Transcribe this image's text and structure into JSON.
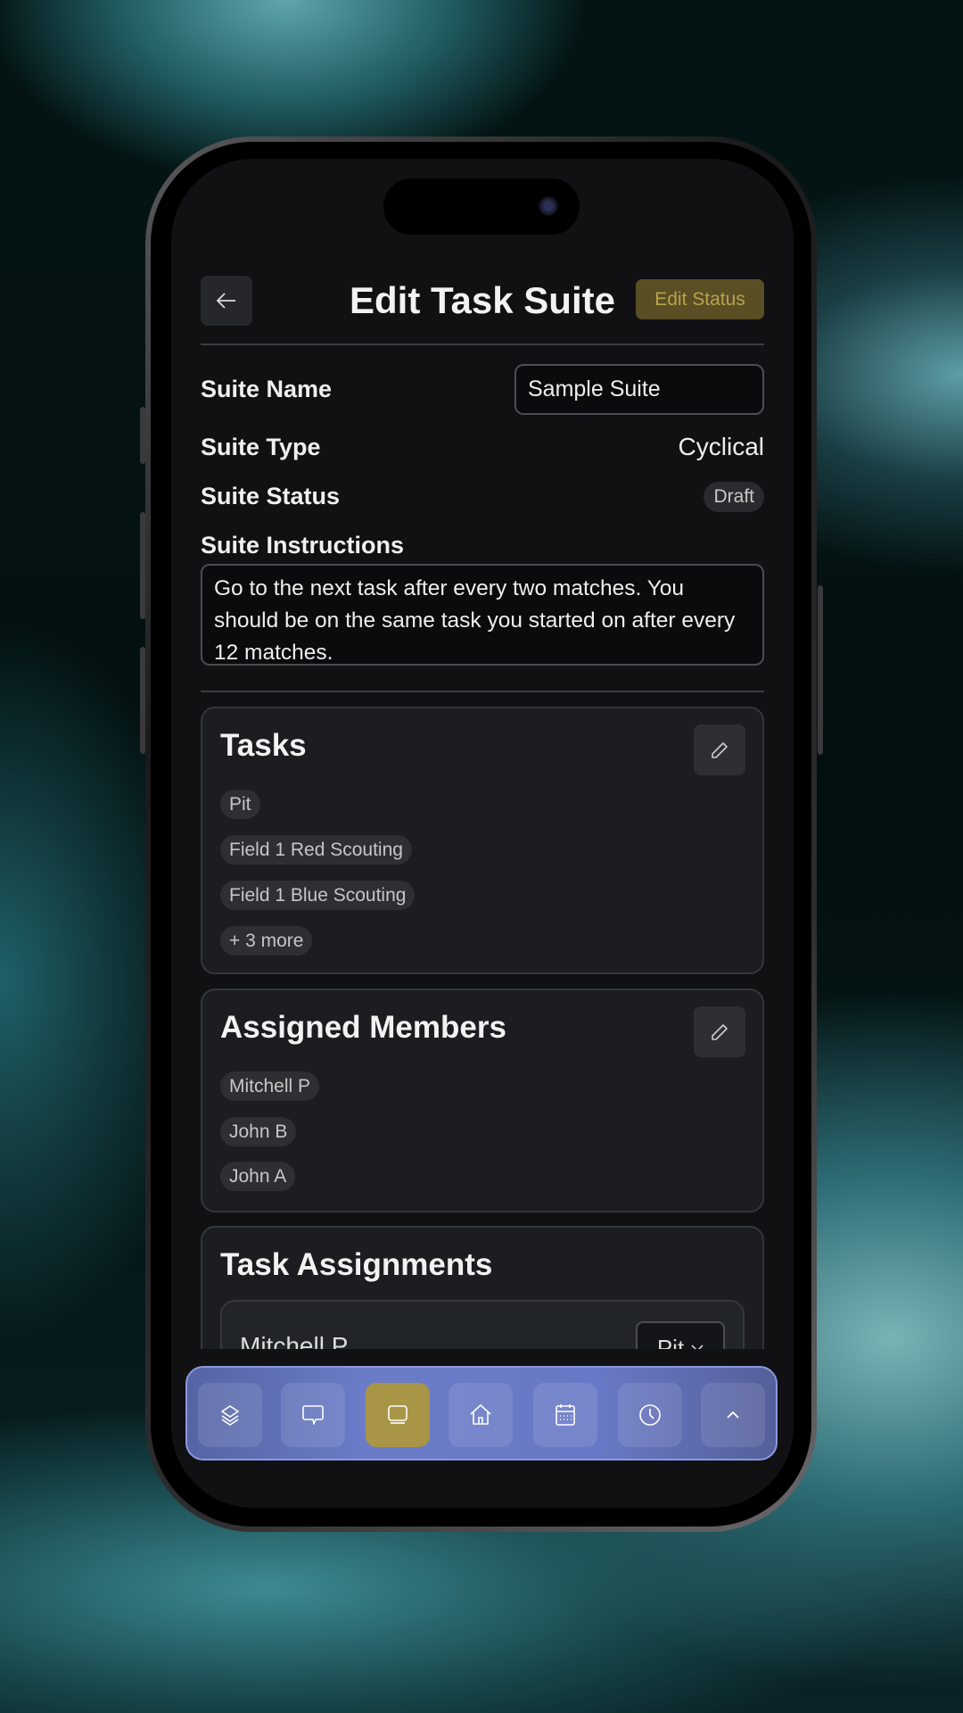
{
  "header": {
    "title": "Edit Task Suite",
    "edit_status_label": "Edit Status"
  },
  "form": {
    "suite_name_label": "Suite Name",
    "suite_name_value": "Sample Suite",
    "suite_type_label": "Suite Type",
    "suite_type_value": "Cyclical",
    "suite_status_label": "Suite Status",
    "suite_status_value": "Draft",
    "suite_instructions_label": "Suite Instructions",
    "suite_instructions_value": "Go to the next task after every two matches. You should be on the same task you started on after every 12 matches."
  },
  "tasks": {
    "title": "Tasks",
    "items": [
      "Pit",
      "Field 1 Red Scouting",
      "Field 1 Blue Scouting",
      "+ 3 more"
    ]
  },
  "members": {
    "title": "Assigned Members",
    "items": [
      "Mitchell P",
      "John B",
      "John A"
    ]
  },
  "assignments": {
    "title": "Task Assignments",
    "rows": [
      {
        "member": "Mitchell P",
        "task": "Pit"
      }
    ]
  },
  "nav": {
    "items": [
      "layers-icon",
      "chat-icon",
      "tablet-icon",
      "home-icon",
      "calendar-icon",
      "clock-icon",
      "chevron-up-icon"
    ],
    "active": "tablet-icon",
    "active_color": "#a89546"
  }
}
